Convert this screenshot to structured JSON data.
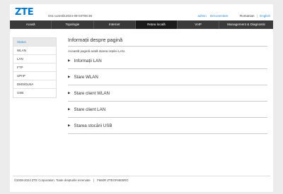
{
  "header": {
    "logo": "ZTE",
    "time": "Ora curentă:2024-09-03T08:36",
    "user": "admin",
    "logout": "Deconectare",
    "lang_ro": "Romanian",
    "lang_sep": "|",
    "lang_en": "English"
  },
  "nav": [
    "Acasă",
    "Topologie",
    "Internet",
    "Rețea locală",
    "VoIP",
    "Management & Diagnostic"
  ],
  "sidebar": [
    "Status",
    "WLAN",
    "LAN",
    "FTP",
    "UPnP",
    "DMS/DLNA",
    "USB"
  ],
  "main": {
    "title": "Informații despre pagină",
    "description": "Această pagină arată starea rețelei LAN.",
    "sections": [
      "Informații LAN",
      "Stare WLAN",
      "Stare client WLAN",
      "Stare client LAN",
      "Starea stocării USB"
    ]
  },
  "footer": {
    "copyright": "©2008-2024 ZTE Corporation. Toate drepturile rezervate",
    "sep": "|",
    "model": "F660R ZTEGF6605RO"
  }
}
